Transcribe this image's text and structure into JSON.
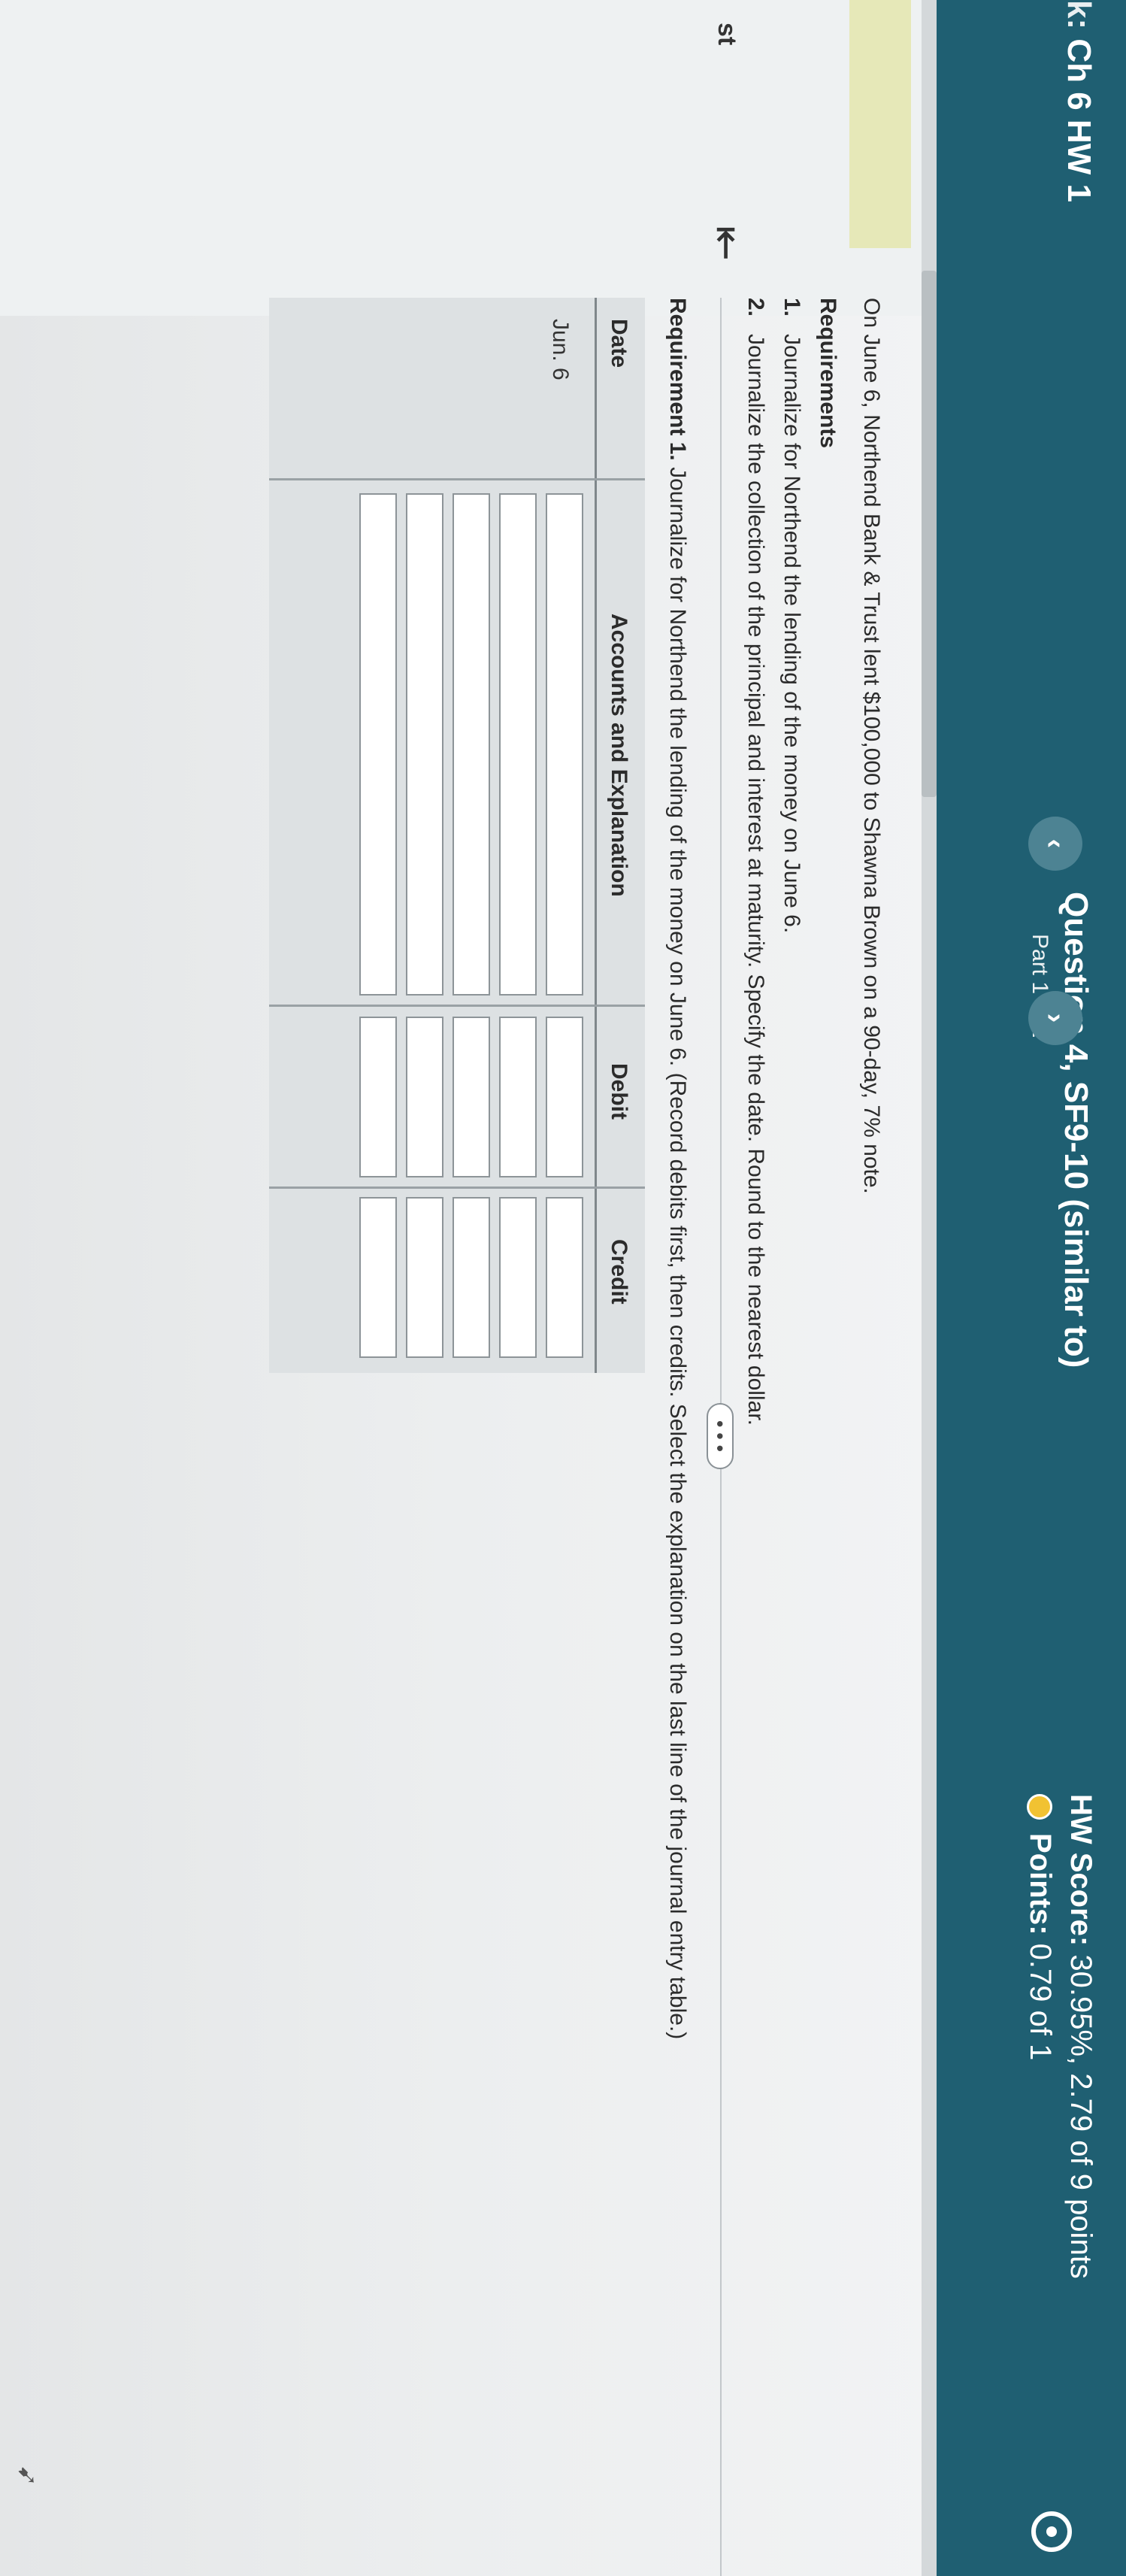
{
  "header": {
    "assignment_prefix": "k: ",
    "assignment_title": "Ch 6 HW 1",
    "question_title": "Question 4, SF9-10 (similar to)",
    "question_part": "Part 1 of 2",
    "prev_icon": "‹",
    "next_icon": "›",
    "hw_score_label": "HW Score:",
    "hw_score_value": "30.95%, 2.79 of 9 points",
    "points_label": "Points:",
    "points_value": "0.79 of 1"
  },
  "sidebar": {
    "label": "st",
    "collapse_icon": "⇤"
  },
  "question": {
    "text": "On June 6, Northend Bank & Trust lent $100,000 to Shawna Brown on a 90-day, 7% note.",
    "requirements_heading": "Requirements",
    "requirements": [
      {
        "num": "1.",
        "text": "Journalize for Northend the lending of the money on June 6."
      },
      {
        "num": "2.",
        "text": "Journalize the collection of the principal and interest at maturity. Specify the date. Round to the nearest dollar."
      }
    ],
    "more_label": "• • •",
    "requirement1_bold": "Requirement 1.",
    "requirement1_text": " Journalize for Northend the lending of the money on June 6. (Record debits first, then credits. Select the explanation on the last line of the journal entry table.)"
  },
  "journal": {
    "headers": {
      "date": "Date",
      "accounts": "Accounts and Explanation",
      "debit": "Debit",
      "credit": "Credit"
    },
    "date_value": "Jun. 6",
    "rows": [
      {
        "account": "",
        "debit": "",
        "credit": ""
      },
      {
        "account": "",
        "debit": "",
        "credit": ""
      },
      {
        "account": "",
        "debit": "",
        "credit": ""
      },
      {
        "account": "",
        "debit": "",
        "credit": ""
      },
      {
        "account": "",
        "debit": "",
        "credit": ""
      }
    ]
  },
  "colors": {
    "header_bg": "#1f5f72",
    "nav_button": "#4d8393",
    "points_icon": "#f1c232"
  }
}
